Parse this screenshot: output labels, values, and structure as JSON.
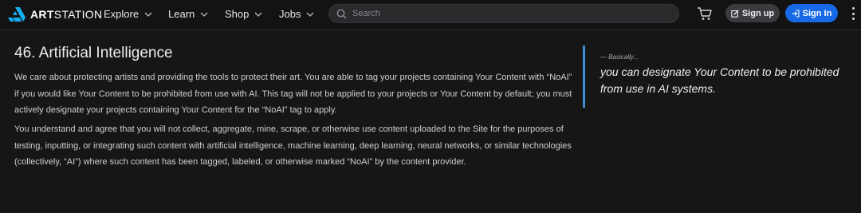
{
  "brand": {
    "name_bold": "ART",
    "name_thin": "STATION",
    "logo_color": "#13aff0"
  },
  "nav": {
    "items": [
      {
        "label": "Explore"
      },
      {
        "label": "Learn"
      },
      {
        "label": "Shop"
      },
      {
        "label": "Jobs"
      }
    ],
    "search_placeholder": "Search",
    "signup_label": "Sign up",
    "signin_label": "Sign In",
    "signin_color": "#1769e6"
  },
  "section": {
    "title": "46. Artificial Intelligence",
    "paragraphs": [
      "We care about protecting artists and providing the tools to protect their art. You are able to tag your projects containing Your Content with “NoAI” if you would like Your Content to be prohibited from use with AI. This tag will not be applied to your projects or Your Content by default; you must actively designate your projects containing Your Content for the “NoAI” tag to apply.",
      "You understand and agree that you will not collect, aggregate, mine, scrape, or otherwise use content uploaded to the Site for the purposes of testing, inputting, or integrating such content with artificial intelligence, machine learning, deep learning, neural networks, or similar technologies (collectively, “AI”) where such content has been tagged, labeled, or otherwise marked “NoAI” by the content provider."
    ]
  },
  "summary": {
    "lead": "— Basically...",
    "quote": "you can designate Your Content to be prohibited from use in AI systems.",
    "accent_color": "#3e8fd6"
  }
}
